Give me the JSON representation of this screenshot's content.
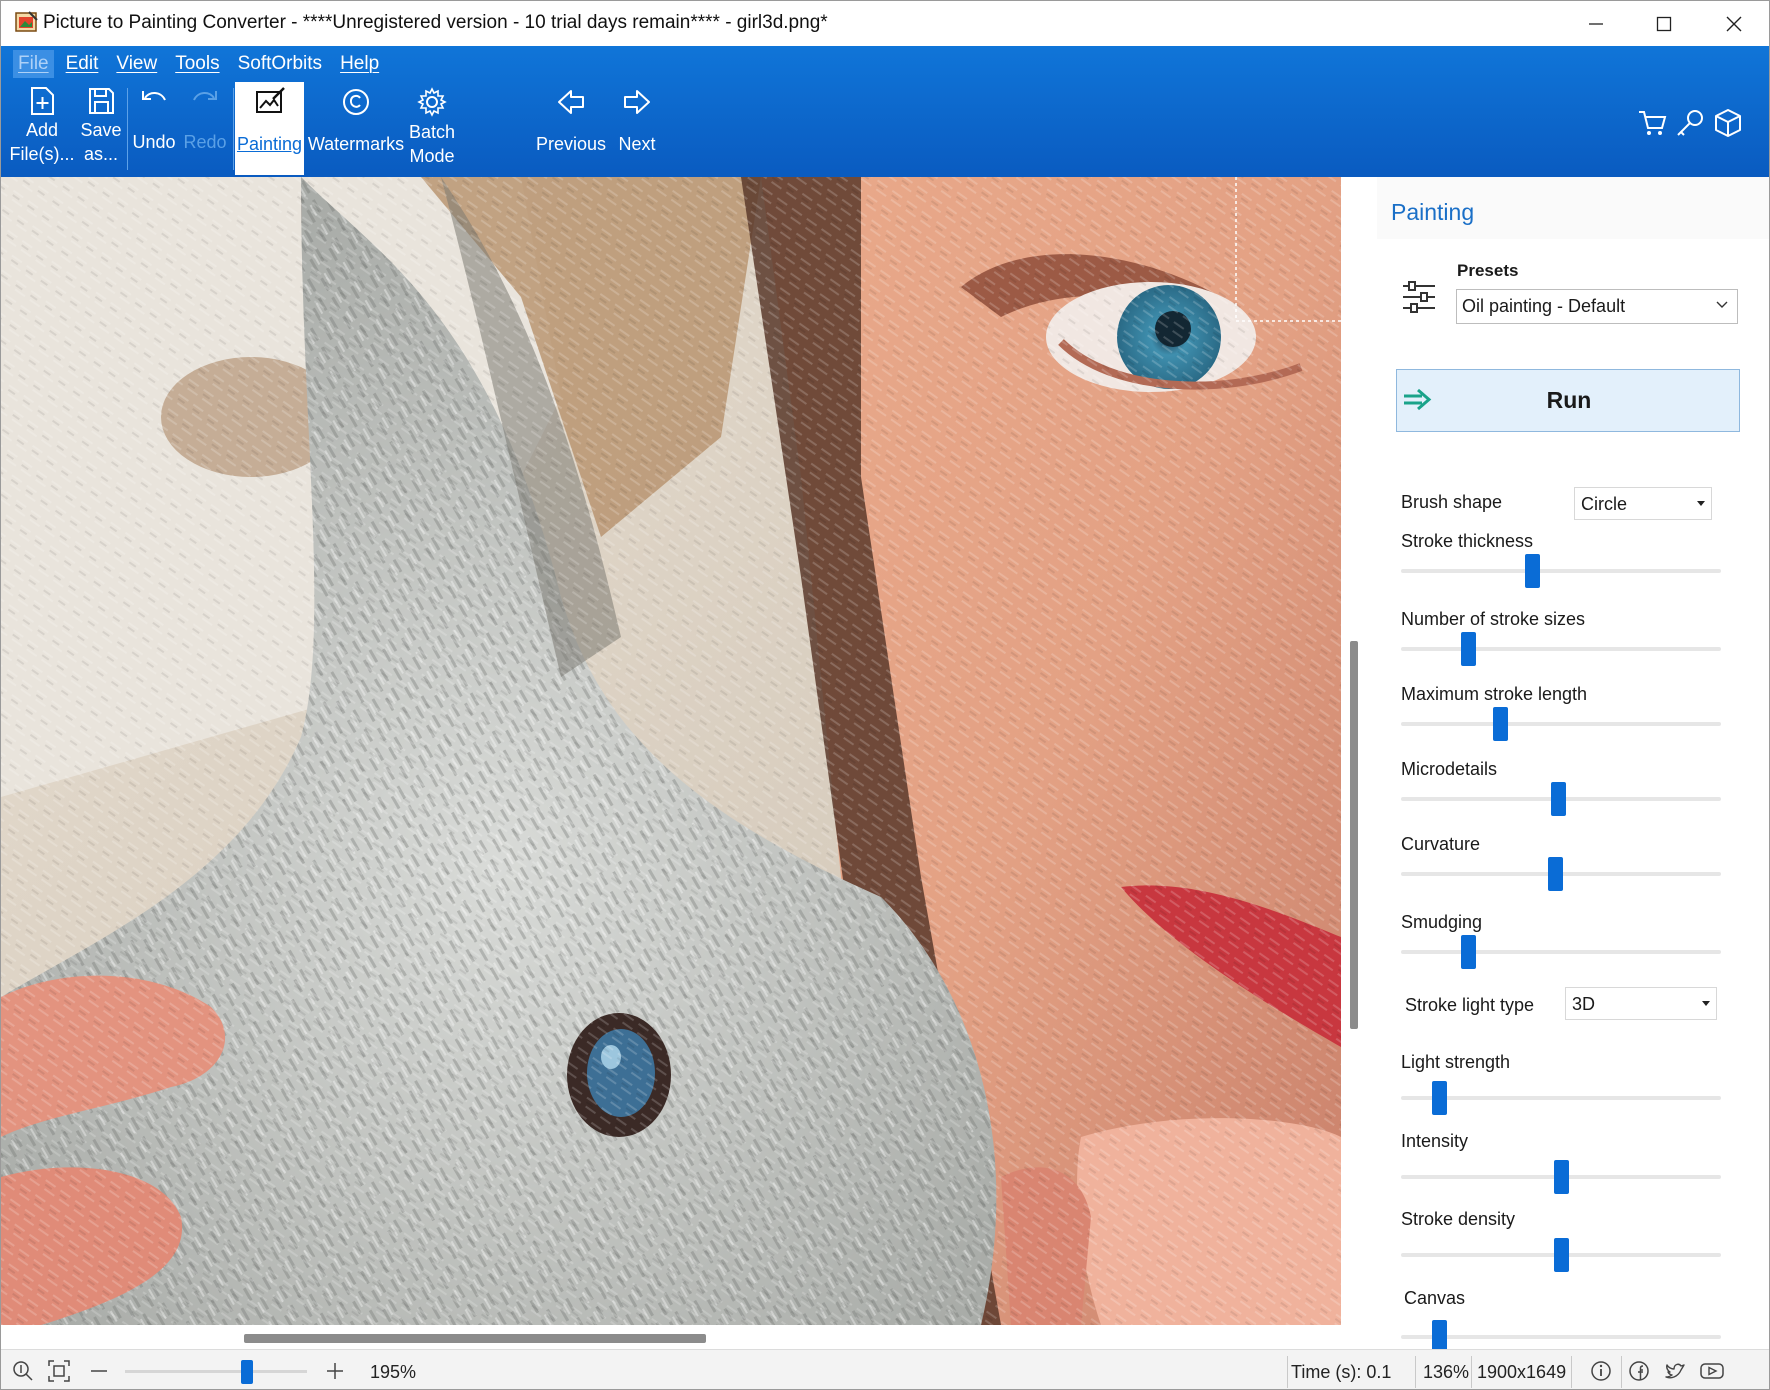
{
  "window": {
    "title": "Picture to Painting Converter - ****Unregistered version - 10 trial days remain**** - girl3d.png*"
  },
  "menu": [
    "File",
    "Edit",
    "View",
    "Tools",
    "SoftOrbits",
    "Help"
  ],
  "toolbar": {
    "add_files": [
      "Add",
      "File(s)..."
    ],
    "save_as": [
      "Save",
      "as..."
    ],
    "undo": "Undo",
    "redo": "Redo",
    "painting": "Painting",
    "watermarks": "Watermarks",
    "batch_mode": [
      "Batch",
      "Mode"
    ],
    "previous": "Previous",
    "next": "Next"
  },
  "panel": {
    "title": "Painting",
    "presets_label": "Presets",
    "preset_value": "Oil painting - Default",
    "run_label": "Run",
    "brush_shape_label": "Brush shape",
    "brush_shape_value": "Circle",
    "stroke_light_type_label": "Stroke light type",
    "stroke_light_type_value": "3D",
    "sliders": [
      {
        "label": "Stroke thickness",
        "value": 0.41
      },
      {
        "label": "Number of stroke sizes",
        "value": 0.21
      },
      {
        "label": "Maximum stroke length",
        "value": 0.31
      },
      {
        "label": "Microdetails",
        "value": 0.49
      },
      {
        "label": "Curvature",
        "value": 0.48
      },
      {
        "label": "Smudging",
        "value": 0.21
      },
      {
        "label": "Light strength",
        "value": 0.12
      },
      {
        "label": "Intensity",
        "value": 0.5
      },
      {
        "label": "Stroke density",
        "value": 0.5
      },
      {
        "label": "Canvas",
        "value": 0.12
      }
    ]
  },
  "statusbar": {
    "zoom_slider_value": 0.67,
    "zoom_percent": "195%",
    "time": "Time (s): 0.1",
    "scale": "136%",
    "dimensions": "1900x1649"
  },
  "colors": {
    "ribbon": "#0a6cd6",
    "accent": "#0a6cd6",
    "panel_title": "#1a6fc7",
    "run_button_bg": "#e3f0fb"
  },
  "icons": [
    "app-icon",
    "minimize-icon",
    "maximize-icon",
    "close-icon",
    "add-file-icon",
    "save-icon",
    "undo-icon",
    "redo-icon",
    "painting-icon",
    "watermark-icon",
    "gear-icon",
    "previous-icon",
    "next-icon",
    "cart-icon",
    "key-icon",
    "box-icon",
    "sliders-icon",
    "arrow-right-icon",
    "info-icon",
    "fit-icon",
    "zoom-out-icon",
    "zoom-in-icon",
    "facebook-icon",
    "twitter-icon",
    "youtube-icon"
  ]
}
